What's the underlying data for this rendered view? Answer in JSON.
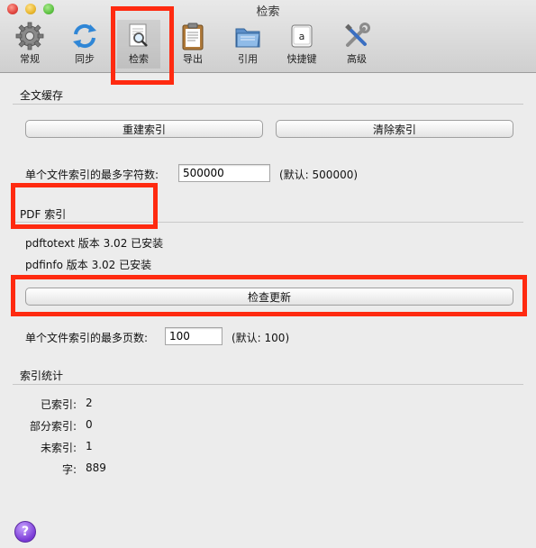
{
  "window": {
    "title": "检索"
  },
  "toolbar": {
    "items": [
      {
        "label": "常规",
        "icon": "gear-icon"
      },
      {
        "label": "同步",
        "icon": "sync-icon"
      },
      {
        "label": "检索",
        "icon": "search-document-icon",
        "selected": true
      },
      {
        "label": "导出",
        "icon": "clipboard-icon"
      },
      {
        "label": "引用",
        "icon": "folder-icon"
      },
      {
        "label": "快捷键",
        "icon": "keyboard-key-icon",
        "key_glyph": "a"
      },
      {
        "label": "高级",
        "icon": "tools-icon"
      }
    ]
  },
  "fulltext": {
    "title": "全文缓存",
    "rebuild_button": "重建索引",
    "clear_button": "清除索引",
    "max_chars_label": "单个文件索引的最多字符数:",
    "max_chars_value": "500000",
    "max_chars_default": "(默认: 500000)"
  },
  "pdf": {
    "title": "PDF 索引",
    "pdftotext_status": "pdftotext 版本 3.02 已安装",
    "pdfinfo_status": "pdfinfo 版本 3.02 已安装",
    "check_updates_button": "检查更新",
    "max_pages_label": "单个文件索引的最多页数:",
    "max_pages_value": "100",
    "max_pages_default": "(默认: 100)"
  },
  "stats": {
    "title": "索引统计",
    "rows": [
      {
        "label": "已索引:",
        "value": "2"
      },
      {
        "label": "部分索引:",
        "value": "0"
      },
      {
        "label": "未索引:",
        "value": "1"
      },
      {
        "label": "字:",
        "value": "889"
      }
    ]
  },
  "help": {
    "glyph": "?"
  },
  "colors": {
    "highlight": "#ff2a10",
    "window_bg": "#ececec"
  }
}
